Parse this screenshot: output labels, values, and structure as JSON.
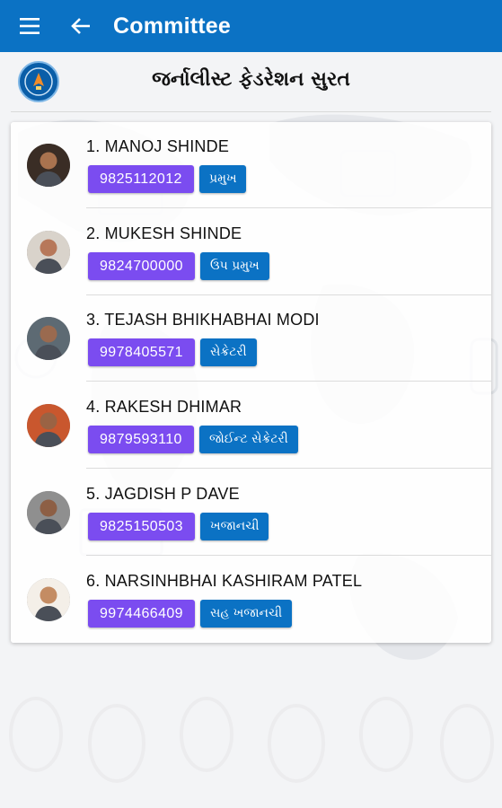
{
  "appbar": {
    "title": "Committee",
    "menu_icon": "menu-icon",
    "back_icon": "arrow-back-icon",
    "color": "#0b72c4"
  },
  "organization": {
    "name": "જર્નાલીસ્ટ ફેડરેશન સુરત",
    "logo": "federation-logo"
  },
  "members": [
    {
      "name": "1. MANOJ SHINDE",
      "phone": "9825112012",
      "role": "પ્રમુખ",
      "avatar_bg": "#3a2d25",
      "skin": "#a9734f"
    },
    {
      "name": "2. MUKESH SHINDE",
      "phone": "9824700000",
      "role": "ઉપ પ્રમુખ",
      "avatar_bg": "#d9d3cb",
      "skin": "#b7785a"
    },
    {
      "name": "3. TEJASH BHIKHABHAI MODI",
      "phone": "9978405571",
      "role": "સેક્રેટરી",
      "avatar_bg": "#5d6a73",
      "skin": "#9a6a4f"
    },
    {
      "name": "4. RAKESH DHIMAR",
      "phone": "9879593110",
      "role": "જોઈન્ટ સેક્રેટરી",
      "avatar_bg": "#c9572e",
      "skin": "#9a6344"
    },
    {
      "name": "5. JAGDISH P DAVE",
      "phone": "9825150503",
      "role": "ખજાનચી",
      "avatar_bg": "#8f8f8f",
      "skin": "#8d5f45"
    },
    {
      "name": "6. NARSINHBHAI KASHIRAM PATEL",
      "phone": "9974466409",
      "role": "સહ ખજાનચી",
      "avatar_bg": "#f4efe8",
      "skin": "#c48c63"
    }
  ],
  "colors": {
    "phone_badge": "#7b4cf0",
    "role_badge": "#0b72c4"
  }
}
